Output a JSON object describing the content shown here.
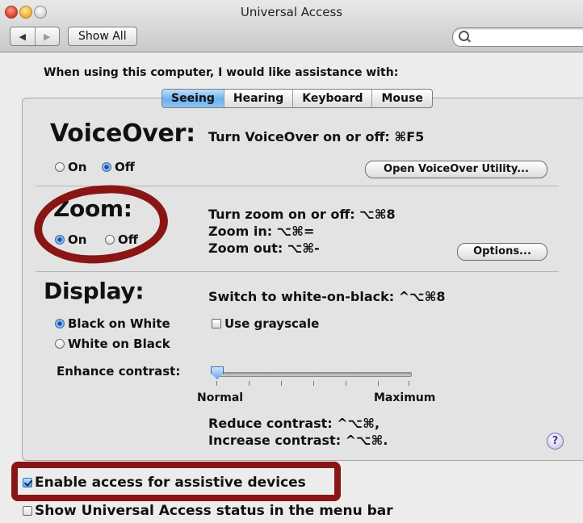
{
  "window": {
    "title": "Universal Access"
  },
  "toolbar": {
    "back": "◀",
    "forward": "▶",
    "show_all": "Show All",
    "search_placeholder": ""
  },
  "intro": "When using this computer, I would like assistance with:",
  "tabs": [
    {
      "label": "Seeing",
      "active": true
    },
    {
      "label": "Hearing",
      "active": false
    },
    {
      "label": "Keyboard",
      "active": false
    },
    {
      "label": "Mouse",
      "active": false
    }
  ],
  "voiceover": {
    "title": "VoiceOver:",
    "shortcut": "Turn VoiceOver on or off: ⌘F5",
    "on": "On",
    "off": "Off",
    "selected": "Off",
    "utility_button": "Open VoiceOver Utility..."
  },
  "zoom": {
    "title": "Zoom:",
    "shortcut_toggle": "Turn zoom on or off: ⌥⌘8",
    "shortcut_in": "Zoom in: ⌥⌘=",
    "shortcut_out": "Zoom out: ⌥⌘-",
    "on": "On",
    "off": "Off",
    "selected": "On",
    "options_button": "Options..."
  },
  "display": {
    "title": "Display:",
    "shortcut": "Switch to white-on-black: ^⌥⌘8",
    "black_on_white": "Black on White",
    "white_on_black": "White on Black",
    "selected": "Black on White",
    "grayscale": "Use grayscale",
    "grayscale_checked": false,
    "contrast_label": "Enhance contrast:",
    "contrast_min": "Normal",
    "contrast_max": "Maximum",
    "contrast_value": 0,
    "reduce_contrast": "Reduce contrast: ^⌥⌘,",
    "increase_contrast": "Increase contrast: ^⌥⌘."
  },
  "help": "?",
  "assistive": {
    "label": "Enable access for assistive devices",
    "checked": true
  },
  "menubar_status": {
    "label": "Show Universal Access status in the menu bar",
    "checked": false
  },
  "colors": {
    "annotation": "#8a1515",
    "selected_tab": "#6cb0ee"
  }
}
